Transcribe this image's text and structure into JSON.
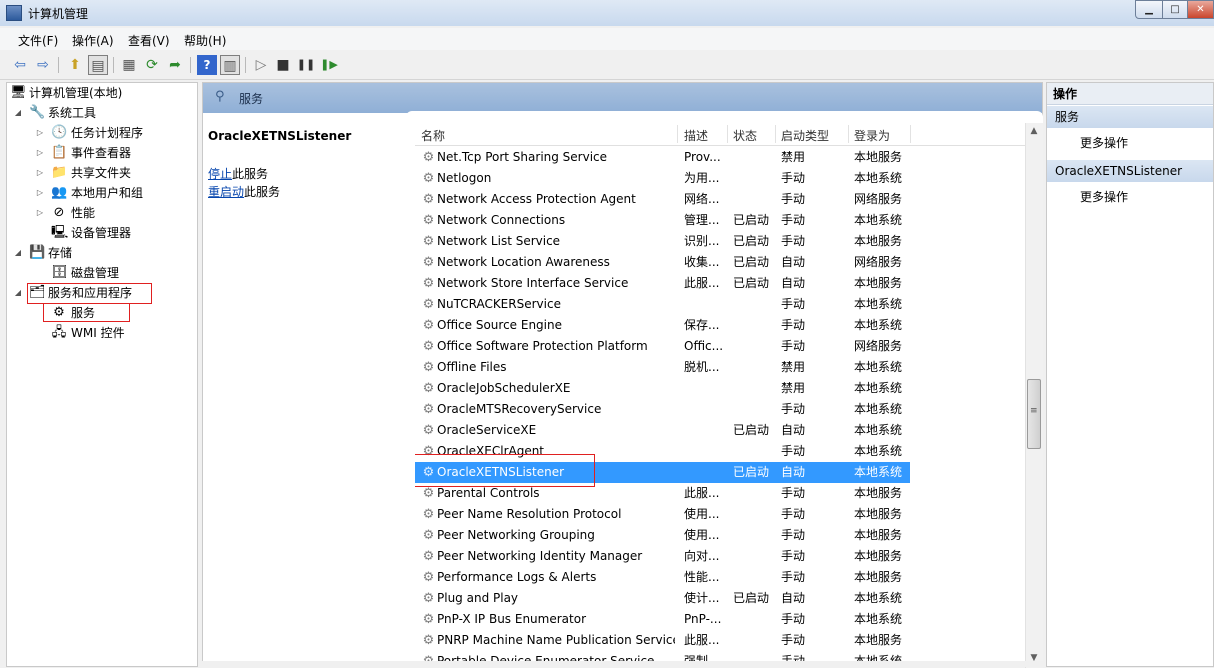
{
  "window": {
    "title": "计算机管理",
    "min": "▁",
    "max": "□",
    "close": "✕"
  },
  "menu": [
    "文件(F)",
    "操作(A)",
    "查看(V)",
    "帮助(H)"
  ],
  "toolbar_icons": [
    "back-icon",
    "forward-icon",
    "up-icon",
    "show-hide-tree-icon",
    "properties-icon",
    "refresh-icon",
    "export-icon",
    "help-icon",
    "show-action-pane-icon",
    "start-icon",
    "stop-icon",
    "pause-icon",
    "restart-icon"
  ],
  "tree": [
    {
      "label": "计算机管理(本地)",
      "level": 0,
      "arrow": "",
      "icon": "🖥"
    },
    {
      "label": "系统工具",
      "level": 1,
      "arrow": "◢",
      "icon": "🔧"
    },
    {
      "label": "任务计划程序",
      "level": 2,
      "arrow": "▷",
      "icon": "🕓"
    },
    {
      "label": "事件查看器",
      "level": 2,
      "arrow": "▷",
      "icon": "📋"
    },
    {
      "label": "共享文件夹",
      "level": 2,
      "arrow": "▷",
      "icon": "📁"
    },
    {
      "label": "本地用户和组",
      "level": 2,
      "arrow": "▷",
      "icon": "👥"
    },
    {
      "label": "性能",
      "level": 2,
      "arrow": "▷",
      "icon": "⊘"
    },
    {
      "label": "设备管理器",
      "level": 2,
      "arrow": "",
      "icon": "🖳"
    },
    {
      "label": "存储",
      "level": 1,
      "arrow": "◢",
      "icon": "💾"
    },
    {
      "label": "磁盘管理",
      "level": 2,
      "arrow": "",
      "icon": "🗄"
    },
    {
      "label": "服务和应用程序",
      "level": 1,
      "arrow": "◢",
      "icon": "🗂"
    },
    {
      "label": "服务",
      "level": 2,
      "arrow": "",
      "icon": "⚙"
    },
    {
      "label": "WMI 控件",
      "level": 2,
      "arrow": "",
      "icon": "🖧"
    }
  ],
  "center": {
    "header": "服务",
    "selected_service": "OracleXETNSListener",
    "stop_link": "停止",
    "stop_suffix": "此服务",
    "restart_link": "重启动",
    "restart_suffix": "此服务"
  },
  "columns": [
    "名称",
    "描述",
    "状态",
    "启动类型",
    "登录为"
  ],
  "sort_indicator": "^",
  "services": [
    {
      "name": "Net.Tcp Port Sharing Service",
      "desc": "Prov...",
      "status": "",
      "startup": "禁用",
      "logon": "本地服务"
    },
    {
      "name": "Netlogon",
      "desc": "为用...",
      "status": "",
      "startup": "手动",
      "logon": "本地系统"
    },
    {
      "name": "Network Access Protection Agent",
      "desc": "网络...",
      "status": "",
      "startup": "手动",
      "logon": "网络服务"
    },
    {
      "name": "Network Connections",
      "desc": "管理...",
      "status": "已启动",
      "startup": "手动",
      "logon": "本地系统"
    },
    {
      "name": "Network List Service",
      "desc": "识别...",
      "status": "已启动",
      "startup": "手动",
      "logon": "本地服务"
    },
    {
      "name": "Network Location Awareness",
      "desc": "收集...",
      "status": "已启动",
      "startup": "自动",
      "logon": "网络服务"
    },
    {
      "name": "Network Store Interface Service",
      "desc": "此服...",
      "status": "已启动",
      "startup": "自动",
      "logon": "本地服务"
    },
    {
      "name": "NuTCRACKERService",
      "desc": "",
      "status": "",
      "startup": "手动",
      "logon": "本地系统"
    },
    {
      "name": "Office  Source Engine",
      "desc": "保存...",
      "status": "",
      "startup": "手动",
      "logon": "本地系统"
    },
    {
      "name": "Office Software Protection Platform",
      "desc": "Offic...",
      "status": "",
      "startup": "手动",
      "logon": "网络服务"
    },
    {
      "name": "Offline Files",
      "desc": "脱机...",
      "status": "",
      "startup": "禁用",
      "logon": "本地系统"
    },
    {
      "name": "OracleJobSchedulerXE",
      "desc": "",
      "status": "",
      "startup": "禁用",
      "logon": "本地系统"
    },
    {
      "name": "OracleMTSRecoveryService",
      "desc": "",
      "status": "",
      "startup": "手动",
      "logon": "本地系统"
    },
    {
      "name": "OracleServiceXE",
      "desc": "",
      "status": "已启动",
      "startup": "自动",
      "logon": "本地系统"
    },
    {
      "name": "OracleXEClrAgent",
      "desc": "",
      "status": "",
      "startup": "手动",
      "logon": "本地系统"
    },
    {
      "name": "OracleXETNSListener",
      "desc": "",
      "status": "已启动",
      "startup": "自动",
      "logon": "本地系统"
    },
    {
      "name": "Parental Controls",
      "desc": "此服...",
      "status": "",
      "startup": "手动",
      "logon": "本地服务"
    },
    {
      "name": "Peer Name Resolution Protocol",
      "desc": "使用...",
      "status": "",
      "startup": "手动",
      "logon": "本地服务"
    },
    {
      "name": "Peer Networking Grouping",
      "desc": "使用...",
      "status": "",
      "startup": "手动",
      "logon": "本地服务"
    },
    {
      "name": "Peer Networking Identity Manager",
      "desc": "向对...",
      "status": "",
      "startup": "手动",
      "logon": "本地服务"
    },
    {
      "name": "Performance Logs & Alerts",
      "desc": "性能...",
      "status": "",
      "startup": "手动",
      "logon": "本地服务"
    },
    {
      "name": "Plug and Play",
      "desc": "使计...",
      "status": "已启动",
      "startup": "自动",
      "logon": "本地系统"
    },
    {
      "name": "PnP-X IP Bus Enumerator",
      "desc": "PnP-...",
      "status": "",
      "startup": "手动",
      "logon": "本地系统"
    },
    {
      "name": "PNRP Machine Name Publication Service",
      "desc": "此服...",
      "status": "",
      "startup": "手动",
      "logon": "本地服务"
    },
    {
      "name": "Portable Device Enumerator Service",
      "desc": "强制...",
      "status": "",
      "startup": "手动",
      "logon": "本地系统"
    }
  ],
  "selected_index": 15,
  "actions": {
    "title": "操作",
    "sections": [
      {
        "header": "服务",
        "items": [
          "更多操作"
        ]
      },
      {
        "header": "OracleXETNSListener",
        "items": [
          "更多操作"
        ]
      }
    ]
  },
  "scroll": {
    "up": "▲",
    "down": "▼",
    "grip": "≡"
  }
}
